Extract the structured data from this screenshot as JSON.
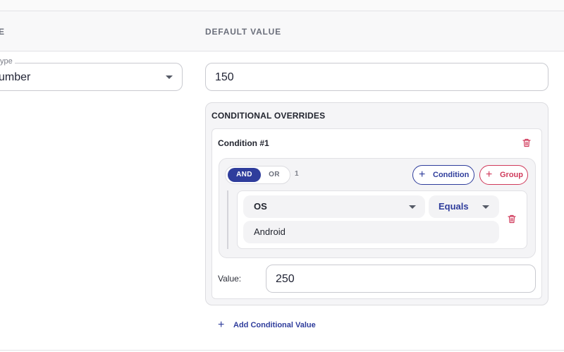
{
  "header": {
    "col_left_fragment": "E",
    "col_default": "DEFAULT VALUE"
  },
  "type_field": {
    "legend": "ype",
    "value": "umber"
  },
  "default_value": "150",
  "overrides": {
    "title": "CONDITIONAL OVERRIDES",
    "conditions": [
      {
        "title": "Condition #1",
        "logic": {
          "and_label": "AND",
          "or_label": "OR",
          "selected": "AND",
          "count": "1"
        },
        "add_condition_label": "Condition",
        "add_group_label": "Group",
        "rules": [
          {
            "field": "OS",
            "operator": "Equals",
            "value": "Android"
          }
        ],
        "value_label": "Value:",
        "value": "250"
      }
    ],
    "add_value_label": "Add Conditional Value"
  },
  "colors": {
    "primary": "#2f3d9c",
    "danger": "#d03a5b",
    "border": "#c9cad0",
    "card_bg": "#f5f5f7"
  },
  "icons": {
    "plus": "+",
    "trash": "trash-icon",
    "caret": "chevron-down-icon"
  }
}
